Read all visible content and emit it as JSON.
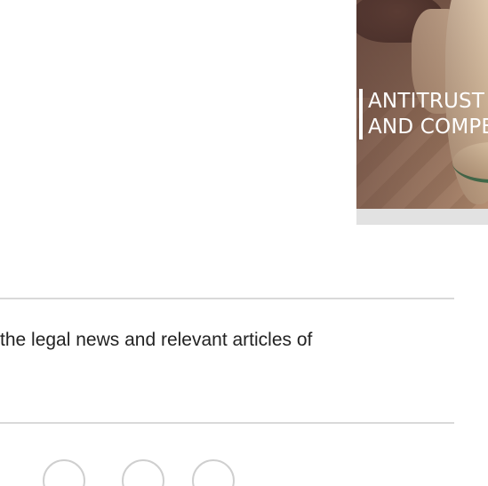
{
  "banner": {
    "title_line1": "ANTITRUST",
    "title_line2": "AND COMPETITION"
  },
  "intro": {
    "text": "the legal news and relevant articles of"
  },
  "social": {
    "items": [
      "share-circle-1",
      "share-circle-2",
      "share-circle-3"
    ]
  },
  "colors": {
    "divider": "#d9d9d9",
    "text": "#222222",
    "banner_overlay": "#5a3c37"
  }
}
